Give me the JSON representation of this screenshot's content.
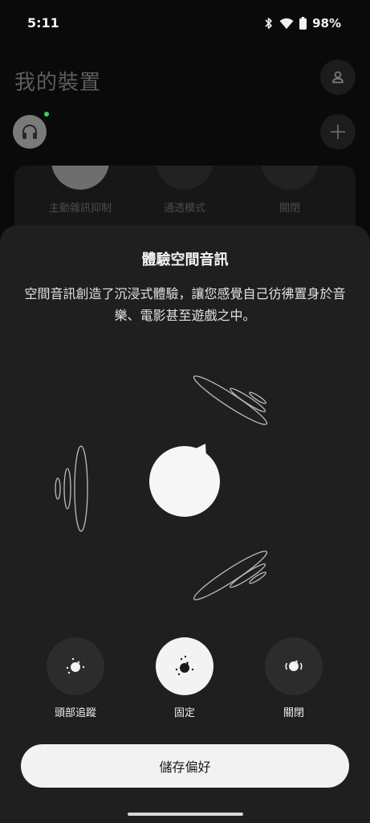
{
  "status_bar": {
    "time": "5:11",
    "battery": "98%",
    "icons": [
      "bluetooth-icon",
      "wifi-icon",
      "battery-icon"
    ]
  },
  "header": {
    "title": "我的裝置",
    "account_icon": "person-icon",
    "add_icon": "plus-icon"
  },
  "device": {
    "icon": "headphones-icon",
    "connected": true,
    "status_color": "#3fd05a"
  },
  "noise_modes": [
    {
      "label": "主動雜訊抑制",
      "selected": true
    },
    {
      "label": "通透模式",
      "selected": false
    },
    {
      "label": "關閉",
      "selected": false
    }
  ],
  "sheet": {
    "title": "體驗空間音訊",
    "description": "空間音訊創造了沉浸式體驗，讓您感覺自己彷彿置身於音樂、電影甚至遊戲之中。",
    "options": [
      {
        "label": "頭部追蹤",
        "icon": "head-tracking-icon",
        "selected": false
      },
      {
        "label": "固定",
        "icon": "fixed-icon",
        "selected": true
      },
      {
        "label": "關閉",
        "icon": "off-icon",
        "selected": false
      }
    ],
    "save_label": "儲存偏好"
  },
  "colors": {
    "background": "#0a0a0a",
    "sheet": "#1f1f1f",
    "button": "#f2f2f2",
    "accent": "#3fd05a"
  }
}
